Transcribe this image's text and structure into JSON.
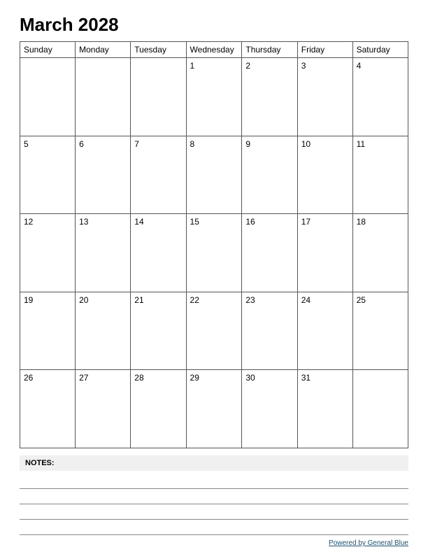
{
  "title": "March 2028",
  "days_of_week": [
    "Sunday",
    "Monday",
    "Tuesday",
    "Wednesday",
    "Thursday",
    "Friday",
    "Saturday"
  ],
  "weeks": [
    [
      "",
      "",
      "",
      "1",
      "2",
      "3",
      "4"
    ],
    [
      "5",
      "6",
      "7",
      "8",
      "9",
      "10",
      "11"
    ],
    [
      "12",
      "13",
      "14",
      "15",
      "16",
      "17",
      "18"
    ],
    [
      "19",
      "20",
      "21",
      "22",
      "23",
      "24",
      "25"
    ],
    [
      "26",
      "27",
      "28",
      "29",
      "30",
      "31",
      ""
    ]
  ],
  "notes_label": "NOTES:",
  "notes_lines_count": 4,
  "footer_text": "Powered by General Blue",
  "footer_url": "#"
}
